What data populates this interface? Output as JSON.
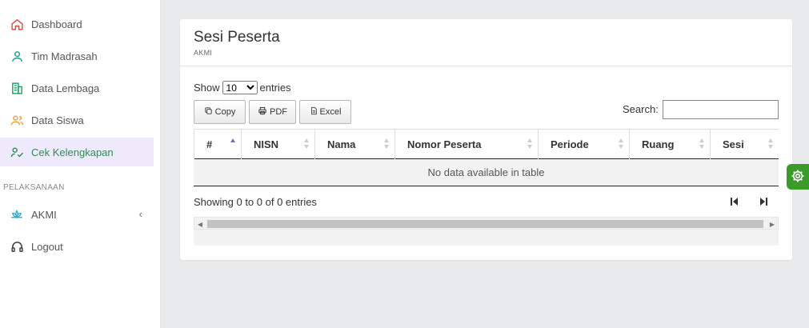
{
  "sidebar": {
    "items": [
      {
        "label": "Dashboard",
        "icon": "home-icon",
        "color": "#e0463c"
      },
      {
        "label": "Tim Madrasah",
        "icon": "user-icon",
        "color": "#1f9e8a"
      },
      {
        "label": "Data Lembaga",
        "icon": "building-icon",
        "color": "#1f9e6a"
      },
      {
        "label": "Data Siswa",
        "icon": "users-icon",
        "color": "#f29a38"
      },
      {
        "label": "Cek Kelengkapan",
        "icon": "user-check-icon",
        "color": "#2e8b57"
      }
    ],
    "section_label": "PELAKSANAAN",
    "akmi_label": "AKMI",
    "akmi_icon": "lotus-icon",
    "logout_label": "Logout",
    "logout_icon": "headset-icon",
    "active_bg": "#efeafb"
  },
  "card": {
    "title": "Sesi Peserta",
    "subtitle": "AKMI"
  },
  "controls": {
    "show_label": "Show",
    "entries_label": "entries",
    "page_length": "10",
    "page_length_options": [
      "10"
    ],
    "copy_label": "Copy",
    "pdf_label": "PDF",
    "excel_label": "Excel",
    "search_label": "Search:",
    "search_value": ""
  },
  "table": {
    "columns": [
      "#",
      "NISN",
      "Nama",
      "Nomor Peserta",
      "Periode",
      "Ruang",
      "Sesi"
    ],
    "empty_message": "No data available in table"
  },
  "footer": {
    "info": "Showing 0 to 0 of 0 entries"
  },
  "colors": {
    "accent_green": "#3a9a2a",
    "sort_active": "#6e6ec8"
  }
}
